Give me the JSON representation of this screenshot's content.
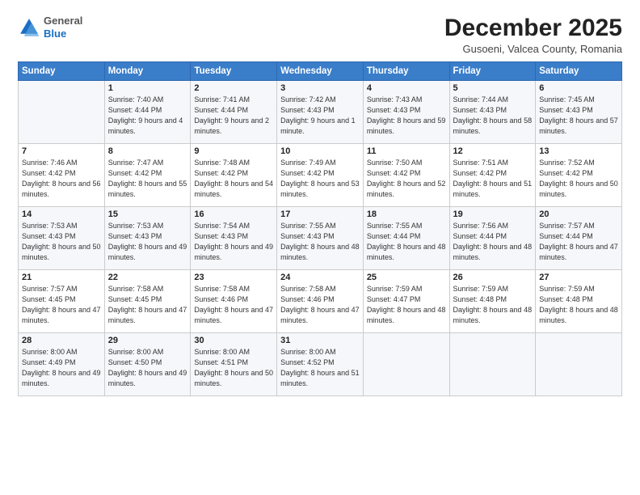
{
  "logo": {
    "general": "General",
    "blue": "Blue"
  },
  "title": "December 2025",
  "subtitle": "Gusoeni, Valcea County, Romania",
  "headers": [
    "Sunday",
    "Monday",
    "Tuesday",
    "Wednesday",
    "Thursday",
    "Friday",
    "Saturday"
  ],
  "weeks": [
    [
      {
        "day": "",
        "sunrise": "",
        "sunset": "",
        "daylight": ""
      },
      {
        "day": "1",
        "sunrise": "Sunrise: 7:40 AM",
        "sunset": "Sunset: 4:44 PM",
        "daylight": "Daylight: 9 hours and 4 minutes."
      },
      {
        "day": "2",
        "sunrise": "Sunrise: 7:41 AM",
        "sunset": "Sunset: 4:44 PM",
        "daylight": "Daylight: 9 hours and 2 minutes."
      },
      {
        "day": "3",
        "sunrise": "Sunrise: 7:42 AM",
        "sunset": "Sunset: 4:43 PM",
        "daylight": "Daylight: 9 hours and 1 minute."
      },
      {
        "day": "4",
        "sunrise": "Sunrise: 7:43 AM",
        "sunset": "Sunset: 4:43 PM",
        "daylight": "Daylight: 8 hours and 59 minutes."
      },
      {
        "day": "5",
        "sunrise": "Sunrise: 7:44 AM",
        "sunset": "Sunset: 4:43 PM",
        "daylight": "Daylight: 8 hours and 58 minutes."
      },
      {
        "day": "6",
        "sunrise": "Sunrise: 7:45 AM",
        "sunset": "Sunset: 4:43 PM",
        "daylight": "Daylight: 8 hours and 57 minutes."
      }
    ],
    [
      {
        "day": "7",
        "sunrise": "Sunrise: 7:46 AM",
        "sunset": "Sunset: 4:42 PM",
        "daylight": "Daylight: 8 hours and 56 minutes."
      },
      {
        "day": "8",
        "sunrise": "Sunrise: 7:47 AM",
        "sunset": "Sunset: 4:42 PM",
        "daylight": "Daylight: 8 hours and 55 minutes."
      },
      {
        "day": "9",
        "sunrise": "Sunrise: 7:48 AM",
        "sunset": "Sunset: 4:42 PM",
        "daylight": "Daylight: 8 hours and 54 minutes."
      },
      {
        "day": "10",
        "sunrise": "Sunrise: 7:49 AM",
        "sunset": "Sunset: 4:42 PM",
        "daylight": "Daylight: 8 hours and 53 minutes."
      },
      {
        "day": "11",
        "sunrise": "Sunrise: 7:50 AM",
        "sunset": "Sunset: 4:42 PM",
        "daylight": "Daylight: 8 hours and 52 minutes."
      },
      {
        "day": "12",
        "sunrise": "Sunrise: 7:51 AM",
        "sunset": "Sunset: 4:42 PM",
        "daylight": "Daylight: 8 hours and 51 minutes."
      },
      {
        "day": "13",
        "sunrise": "Sunrise: 7:52 AM",
        "sunset": "Sunset: 4:42 PM",
        "daylight": "Daylight: 8 hours and 50 minutes."
      }
    ],
    [
      {
        "day": "14",
        "sunrise": "Sunrise: 7:53 AM",
        "sunset": "Sunset: 4:43 PM",
        "daylight": "Daylight: 8 hours and 50 minutes."
      },
      {
        "day": "15",
        "sunrise": "Sunrise: 7:53 AM",
        "sunset": "Sunset: 4:43 PM",
        "daylight": "Daylight: 8 hours and 49 minutes."
      },
      {
        "day": "16",
        "sunrise": "Sunrise: 7:54 AM",
        "sunset": "Sunset: 4:43 PM",
        "daylight": "Daylight: 8 hours and 49 minutes."
      },
      {
        "day": "17",
        "sunrise": "Sunrise: 7:55 AM",
        "sunset": "Sunset: 4:43 PM",
        "daylight": "Daylight: 8 hours and 48 minutes."
      },
      {
        "day": "18",
        "sunrise": "Sunrise: 7:55 AM",
        "sunset": "Sunset: 4:44 PM",
        "daylight": "Daylight: 8 hours and 48 minutes."
      },
      {
        "day": "19",
        "sunrise": "Sunrise: 7:56 AM",
        "sunset": "Sunset: 4:44 PM",
        "daylight": "Daylight: 8 hours and 48 minutes."
      },
      {
        "day": "20",
        "sunrise": "Sunrise: 7:57 AM",
        "sunset": "Sunset: 4:44 PM",
        "daylight": "Daylight: 8 hours and 47 minutes."
      }
    ],
    [
      {
        "day": "21",
        "sunrise": "Sunrise: 7:57 AM",
        "sunset": "Sunset: 4:45 PM",
        "daylight": "Daylight: 8 hours and 47 minutes."
      },
      {
        "day": "22",
        "sunrise": "Sunrise: 7:58 AM",
        "sunset": "Sunset: 4:45 PM",
        "daylight": "Daylight: 8 hours and 47 minutes."
      },
      {
        "day": "23",
        "sunrise": "Sunrise: 7:58 AM",
        "sunset": "Sunset: 4:46 PM",
        "daylight": "Daylight: 8 hours and 47 minutes."
      },
      {
        "day": "24",
        "sunrise": "Sunrise: 7:58 AM",
        "sunset": "Sunset: 4:46 PM",
        "daylight": "Daylight: 8 hours and 47 minutes."
      },
      {
        "day": "25",
        "sunrise": "Sunrise: 7:59 AM",
        "sunset": "Sunset: 4:47 PM",
        "daylight": "Daylight: 8 hours and 48 minutes."
      },
      {
        "day": "26",
        "sunrise": "Sunrise: 7:59 AM",
        "sunset": "Sunset: 4:48 PM",
        "daylight": "Daylight: 8 hours and 48 minutes."
      },
      {
        "day": "27",
        "sunrise": "Sunrise: 7:59 AM",
        "sunset": "Sunset: 4:48 PM",
        "daylight": "Daylight: 8 hours and 48 minutes."
      }
    ],
    [
      {
        "day": "28",
        "sunrise": "Sunrise: 8:00 AM",
        "sunset": "Sunset: 4:49 PM",
        "daylight": "Daylight: 8 hours and 49 minutes."
      },
      {
        "day": "29",
        "sunrise": "Sunrise: 8:00 AM",
        "sunset": "Sunset: 4:50 PM",
        "daylight": "Daylight: 8 hours and 49 minutes."
      },
      {
        "day": "30",
        "sunrise": "Sunrise: 8:00 AM",
        "sunset": "Sunset: 4:51 PM",
        "daylight": "Daylight: 8 hours and 50 minutes."
      },
      {
        "day": "31",
        "sunrise": "Sunrise: 8:00 AM",
        "sunset": "Sunset: 4:52 PM",
        "daylight": "Daylight: 8 hours and 51 minutes."
      },
      {
        "day": "",
        "sunrise": "",
        "sunset": "",
        "daylight": ""
      },
      {
        "day": "",
        "sunrise": "",
        "sunset": "",
        "daylight": ""
      },
      {
        "day": "",
        "sunrise": "",
        "sunset": "",
        "daylight": ""
      }
    ]
  ]
}
